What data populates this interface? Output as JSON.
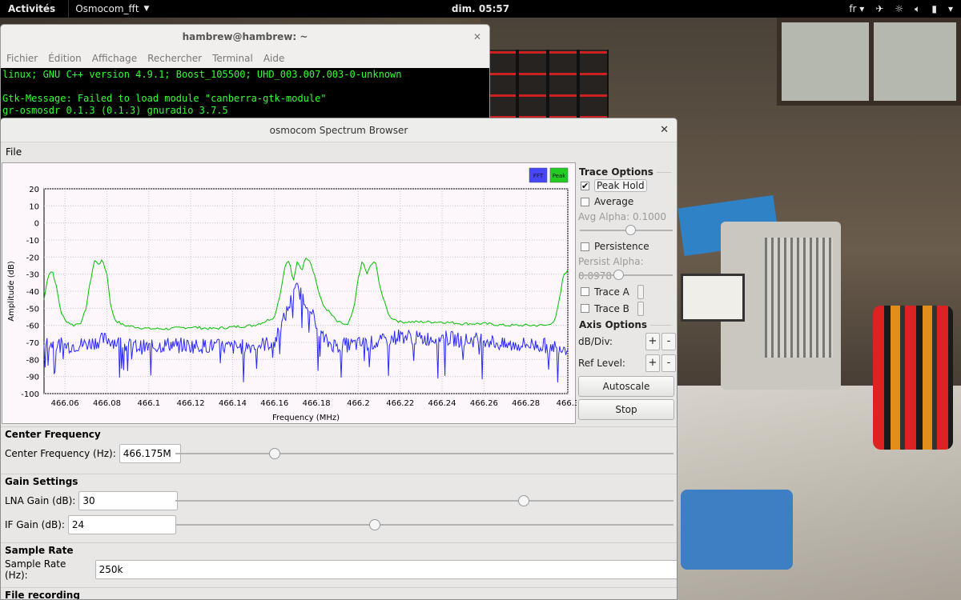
{
  "topbar": {
    "activities": "Activités",
    "app_name": "Osmocom_fft",
    "clock": "dim. 05:57",
    "keyboard_layout": "fr"
  },
  "terminal": {
    "title": "hambrew@hambrew: ~",
    "menu": [
      "Fichier",
      "Édition",
      "Affichage",
      "Rechercher",
      "Terminal",
      "Aide"
    ],
    "lines": [
      "linux; GNU C++ version 4.9.1; Boost_105500; UHD_003.007.003-0-unknown",
      "",
      "Gtk-Message: Failed to load module \"canberra-gtk-module\"",
      "gr-osmosdr 0.1.3 (0.1.3) gnuradio 3.7.5"
    ]
  },
  "window": {
    "title": "osmocom Spectrum Browser",
    "menu_file": "File"
  },
  "trace_options": {
    "header": "Trace Options",
    "peak_hold": "Peak Hold",
    "peak_hold_checked": true,
    "average": "Average",
    "average_checked": false,
    "avg_alpha": "Avg Alpha: 0.1000",
    "avg_alpha_level": 0.55,
    "persistence": "Persistence",
    "persistence_checked": false,
    "persist_alpha": "Persist Alpha: 0.0978",
    "persist_alpha_level": 0.42,
    "trace_a": "Trace A",
    "trace_b": "Trace B"
  },
  "axis_options": {
    "header": "Axis Options",
    "db_div": "dB/Div:",
    "ref_level": "Ref Level:",
    "plus": "+",
    "minus": "-",
    "autoscale": "Autoscale",
    "stop": "Stop"
  },
  "center_frequency": {
    "header": "Center Frequency",
    "label": "Center Frequency (Hz):",
    "value": "466.175M",
    "slider_level": 0.2
  },
  "gain": {
    "header": "Gain Settings",
    "lna_label": "LNA Gain (dB):",
    "lna_value": "30",
    "lna_level": 0.7,
    "if_label": "IF Gain (dB):",
    "if_value": "24",
    "if_level": 0.4
  },
  "sample_rate": {
    "header": "Sample Rate",
    "label": "Sample Rate (Hz):",
    "value": "250k"
  },
  "file_recording": {
    "header": "File recording"
  },
  "chart_data": {
    "type": "line",
    "xlabel": "Frequency (MHz)",
    "ylabel": "Amplitude (dB)",
    "xlim": [
      466.05,
      466.3
    ],
    "ylim": [
      -100,
      20
    ],
    "x_ticks": [
      "466.06",
      "466.08",
      "466.1",
      "466.12",
      "466.14",
      "466.16",
      "466.18",
      "466.2",
      "466.22",
      "466.24",
      "466.26",
      "466.28",
      "466.3"
    ],
    "y_ticks": [
      "20",
      "10",
      "0",
      "-10",
      "-20",
      "-30",
      "-40",
      "-50",
      "-60",
      "-70",
      "-80",
      "-90",
      "-100"
    ],
    "grid": true,
    "legend": [
      "FFT",
      "Peak"
    ],
    "series": [
      {
        "name": "Peak",
        "color": "#00c000",
        "x": [
          466.05,
          466.052,
          466.054,
          466.056,
          466.058,
          466.06,
          466.064,
          466.068,
          466.07,
          466.072,
          466.074,
          466.076,
          466.078,
          466.08,
          466.082,
          466.084,
          466.088,
          466.094,
          466.1,
          466.11,
          466.12,
          466.13,
          466.14,
          466.15,
          466.155,
          466.16,
          466.163,
          466.165,
          466.167,
          466.169,
          466.171,
          466.173,
          466.175,
          466.177,
          466.179,
          466.181,
          466.183,
          466.186,
          466.19,
          466.195,
          466.198,
          466.2,
          466.202,
          466.204,
          466.206,
          466.208,
          466.21,
          466.212,
          466.215,
          466.22,
          466.23,
          466.24,
          466.25,
          466.26,
          466.27,
          466.28,
          466.29,
          466.294,
          466.296,
          466.298,
          466.3
        ],
        "y": [
          -45,
          -30,
          -28,
          -38,
          -52,
          -57,
          -60,
          -58,
          -50,
          -35,
          -22,
          -24,
          -22,
          -30,
          -50,
          -57,
          -60,
          -61,
          -62,
          -62,
          -61,
          -62,
          -61,
          -60,
          -58,
          -55,
          -40,
          -25,
          -22,
          -35,
          -22,
          -28,
          -20,
          -22,
          -30,
          -40,
          -48,
          -52,
          -58,
          -60,
          -50,
          -32,
          -22,
          -30,
          -25,
          -22,
          -35,
          -45,
          -55,
          -58,
          -58,
          -58,
          -59,
          -59,
          -60,
          -60,
          -60,
          -57,
          -45,
          -30,
          -28
        ]
      },
      {
        "name": "FFT",
        "color": "#2828ff",
        "x": [
          466.05,
          466.06,
          466.07,
          466.08,
          466.09,
          466.1,
          466.11,
          466.12,
          466.13,
          466.14,
          466.15,
          466.16,
          466.165,
          466.168,
          466.171,
          466.174,
          466.177,
          466.18,
          466.185,
          466.19,
          466.2,
          466.21,
          466.22,
          466.23,
          466.24,
          466.25,
          466.26,
          466.27,
          466.28,
          466.29,
          466.3
        ],
        "y": [
          -70,
          -72,
          -71,
          -68,
          -72,
          -73,
          -71,
          -72,
          -72,
          -73,
          -72,
          -70,
          -55,
          -45,
          -38,
          -45,
          -48,
          -62,
          -70,
          -72,
          -71,
          -70,
          -66,
          -68,
          -67,
          -69,
          -68,
          -72,
          -71,
          -72,
          -73
        ]
      }
    ]
  }
}
